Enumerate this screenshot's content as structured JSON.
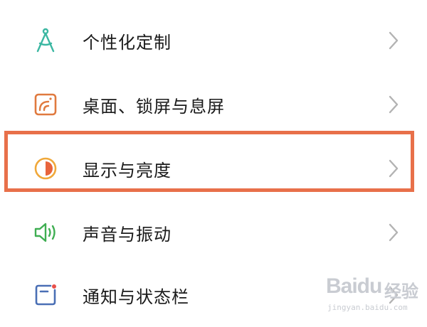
{
  "settings": {
    "items": [
      {
        "label": "个性化定制",
        "icon": "compass-icon",
        "icon_color": "#3bb7a2"
      },
      {
        "label": "桌面、锁屏与息屏",
        "icon": "wallpaper-icon",
        "icon_color": "#e07a3f"
      },
      {
        "label": "显示与亮度",
        "icon": "brightness-icon",
        "icon_color": "#f0a83a"
      },
      {
        "label": "声音与振动",
        "icon": "speaker-icon",
        "icon_color": "#3fae52"
      },
      {
        "label": "通知与状态栏",
        "icon": "notification-icon",
        "icon_color": "#4a6fb5"
      }
    ],
    "highlight_color": "#e8704a"
  },
  "watermark": {
    "brand": "Baidu",
    "suffix": "经验",
    "url": "jingyan.baidu.com"
  }
}
